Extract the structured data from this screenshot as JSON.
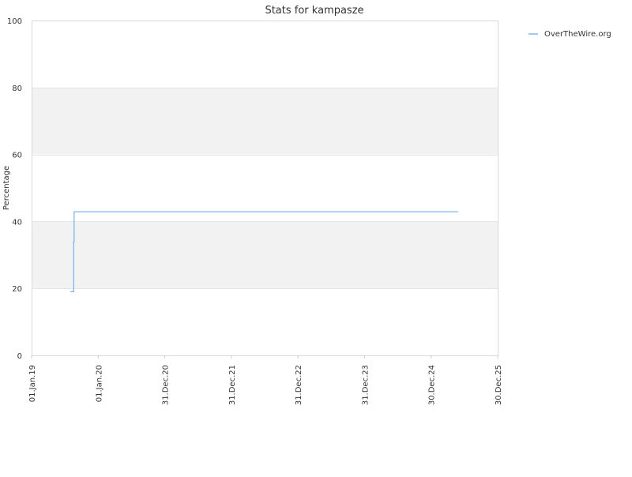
{
  "chart_data": {
    "type": "line",
    "title": "Stats for kampasze",
    "xlabel": "",
    "ylabel": "Percentage",
    "ylim": [
      0,
      100
    ],
    "y_ticks": [
      0,
      20,
      40,
      60,
      80,
      100
    ],
    "x_ticks": [
      "01.Jan.19",
      "01.Jan.20",
      "31.Dec.20",
      "31.Dec.21",
      "31.Dec.22",
      "31.Dec.23",
      "30.Dec.24",
      "30.Dec.25"
    ],
    "xlim": [
      "2019-01-01",
      "2025-12-30"
    ],
    "grid": true,
    "legend": "top-right",
    "series": [
      {
        "name": "OverTheWire.org",
        "color": "#7cb5ec",
        "step": true,
        "points": [
          {
            "x": "2019-08-01",
            "y": 19
          },
          {
            "x": "2019-08-20",
            "y": 19
          },
          {
            "x": "2019-08-20",
            "y": 34
          },
          {
            "x": "2019-08-22",
            "y": 34
          },
          {
            "x": "2019-08-22",
            "y": 42.9
          },
          {
            "x": "2025-05-26",
            "y": 42.9
          }
        ]
      }
    ]
  }
}
